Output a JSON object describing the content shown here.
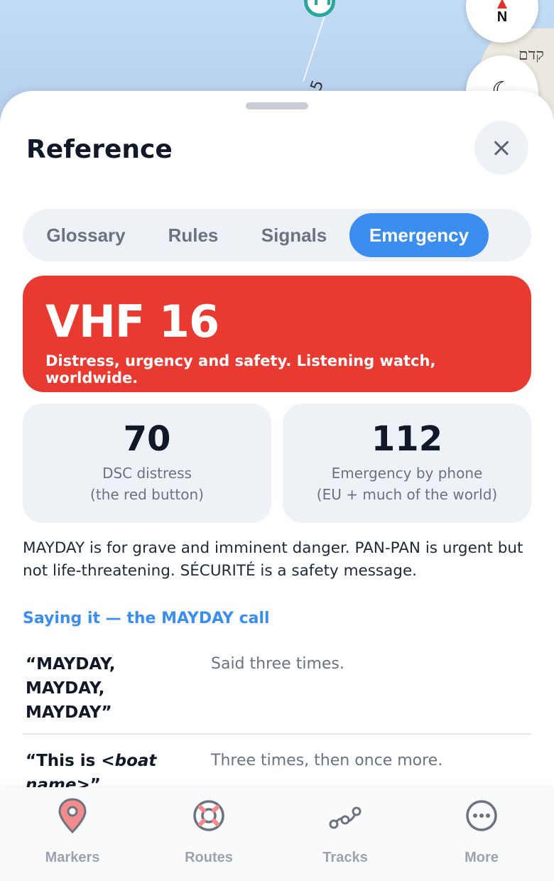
{
  "map": {
    "place_label": "קדם",
    "route_number": "5",
    "compass_label": "N"
  },
  "sheet": {
    "title": "Reference",
    "tabs": [
      {
        "label": "Glossary",
        "active": false
      },
      {
        "label": "Rules",
        "active": false
      },
      {
        "label": "Signals",
        "active": false
      },
      {
        "label": "Emergency",
        "active": true
      }
    ],
    "hero": {
      "title": "VHF 16",
      "subtitle": "Distress, urgency and safety. Listening watch, worldwide."
    },
    "stats": [
      {
        "value": "70",
        "line1": "DSC distress",
        "line2": "(the red button)"
      },
      {
        "value": "112",
        "line1": "Emergency by phone",
        "line2": "(EU + much of the world)"
      }
    ],
    "paragraph": "MAYDAY is for grave and imminent danger. PAN-PAN is urgent but not life-threatening. SÉCURITÉ is a safety message.",
    "section_title": "Saying it — the MAYDAY call",
    "call_rows": [
      {
        "phrase": "“MAYDAY, MAYDAY, MAYDAY”",
        "note": "Said three times."
      },
      {
        "phrase_prefix": "“This is <",
        "phrase_italic": "boat name",
        "phrase_suffix": ">”",
        "note": "Three times, then once more."
      }
    ]
  },
  "nav": {
    "items": [
      {
        "label": "Markers",
        "icon": "pin-icon"
      },
      {
        "label": "Routes",
        "icon": "lifebuoy-icon"
      },
      {
        "label": "Tracks",
        "icon": "track-icon"
      },
      {
        "label": "More",
        "icon": "more-icon"
      }
    ]
  },
  "colors": {
    "accent": "#3b8ef0",
    "emergency_red": "#e93a31",
    "pin_red": "#f28b8b"
  }
}
